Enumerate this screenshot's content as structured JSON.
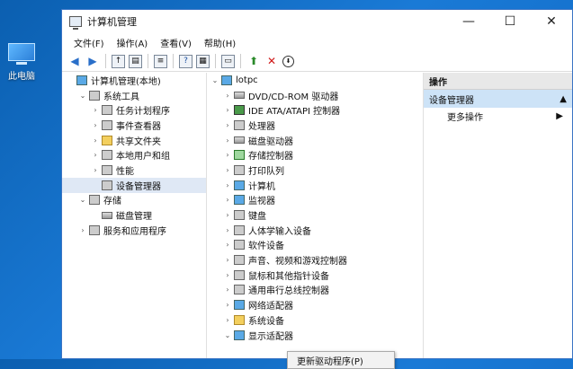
{
  "desktop": {
    "icon_label": "此电脑"
  },
  "window": {
    "title": "计算机管理",
    "minimize": "—",
    "maximize": "☐",
    "close": "✕"
  },
  "menu": [
    "文件(F)",
    "操作(A)",
    "查看(V)",
    "帮助(H)"
  ],
  "left_tree": [
    {
      "label": "计算机管理(本地)",
      "level": 0,
      "caret": "",
      "icon": "monitor"
    },
    {
      "label": "系统工具",
      "level": 1,
      "caret": "⌄",
      "icon": "gray"
    },
    {
      "label": "任务计划程序",
      "level": 2,
      "caret": "›",
      "icon": "gray"
    },
    {
      "label": "事件查看器",
      "level": 2,
      "caret": "›",
      "icon": "gray"
    },
    {
      "label": "共享文件夹",
      "level": 2,
      "caret": "›",
      "icon": "folder"
    },
    {
      "label": "本地用户和组",
      "level": 2,
      "caret": "›",
      "icon": "gray"
    },
    {
      "label": "性能",
      "level": 2,
      "caret": "›",
      "icon": "gray"
    },
    {
      "label": "设备管理器",
      "level": 2,
      "caret": "",
      "icon": "gray",
      "selected": true
    },
    {
      "label": "存储",
      "level": 1,
      "caret": "⌄",
      "icon": "gray"
    },
    {
      "label": "磁盘管理",
      "level": 2,
      "caret": "",
      "icon": "drive"
    },
    {
      "label": "服务和应用程序",
      "level": 1,
      "caret": "›",
      "icon": "gray"
    }
  ],
  "device_tree": [
    {
      "label": "lotpc",
      "level": 0,
      "caret": "⌄",
      "icon": "monitor"
    },
    {
      "label": "DVD/CD-ROM 驱动器",
      "level": 1,
      "caret": "›",
      "icon": "drive"
    },
    {
      "label": "IDE ATA/ATAPI 控制器",
      "level": 1,
      "caret": "›",
      "icon": "chip"
    },
    {
      "label": "处理器",
      "level": 1,
      "caret": "›",
      "icon": "gray"
    },
    {
      "label": "磁盘驱动器",
      "level": 1,
      "caret": "›",
      "icon": "drive"
    },
    {
      "label": "存储控制器",
      "level": 1,
      "caret": "›",
      "icon": "green"
    },
    {
      "label": "打印队列",
      "level": 1,
      "caret": "›",
      "icon": "gray"
    },
    {
      "label": "计算机",
      "level": 1,
      "caret": "›",
      "icon": "monitor"
    },
    {
      "label": "监视器",
      "level": 1,
      "caret": "›",
      "icon": "monitor"
    },
    {
      "label": "键盘",
      "level": 1,
      "caret": "›",
      "icon": "gray"
    },
    {
      "label": "人体学输入设备",
      "level": 1,
      "caret": "›",
      "icon": "gray"
    },
    {
      "label": "软件设备",
      "level": 1,
      "caret": "›",
      "icon": "gray"
    },
    {
      "label": "声音、视频和游戏控制器",
      "level": 1,
      "caret": "›",
      "icon": "gray"
    },
    {
      "label": "鼠标和其他指针设备",
      "level": 1,
      "caret": "›",
      "icon": "gray"
    },
    {
      "label": "通用串行总线控制器",
      "level": 1,
      "caret": "›",
      "icon": "gray"
    },
    {
      "label": "网络适配器",
      "level": 1,
      "caret": "›",
      "icon": "monitor"
    },
    {
      "label": "系统设备",
      "level": 1,
      "caret": "›",
      "icon": "folder"
    },
    {
      "label": "显示适配器",
      "level": 1,
      "caret": "⌄",
      "icon": "monitor"
    }
  ],
  "actions": {
    "header": "操作",
    "selected": "设备管理器",
    "more": "更多操作"
  },
  "context_menu": {
    "item": "更新驱动程序(P)"
  }
}
